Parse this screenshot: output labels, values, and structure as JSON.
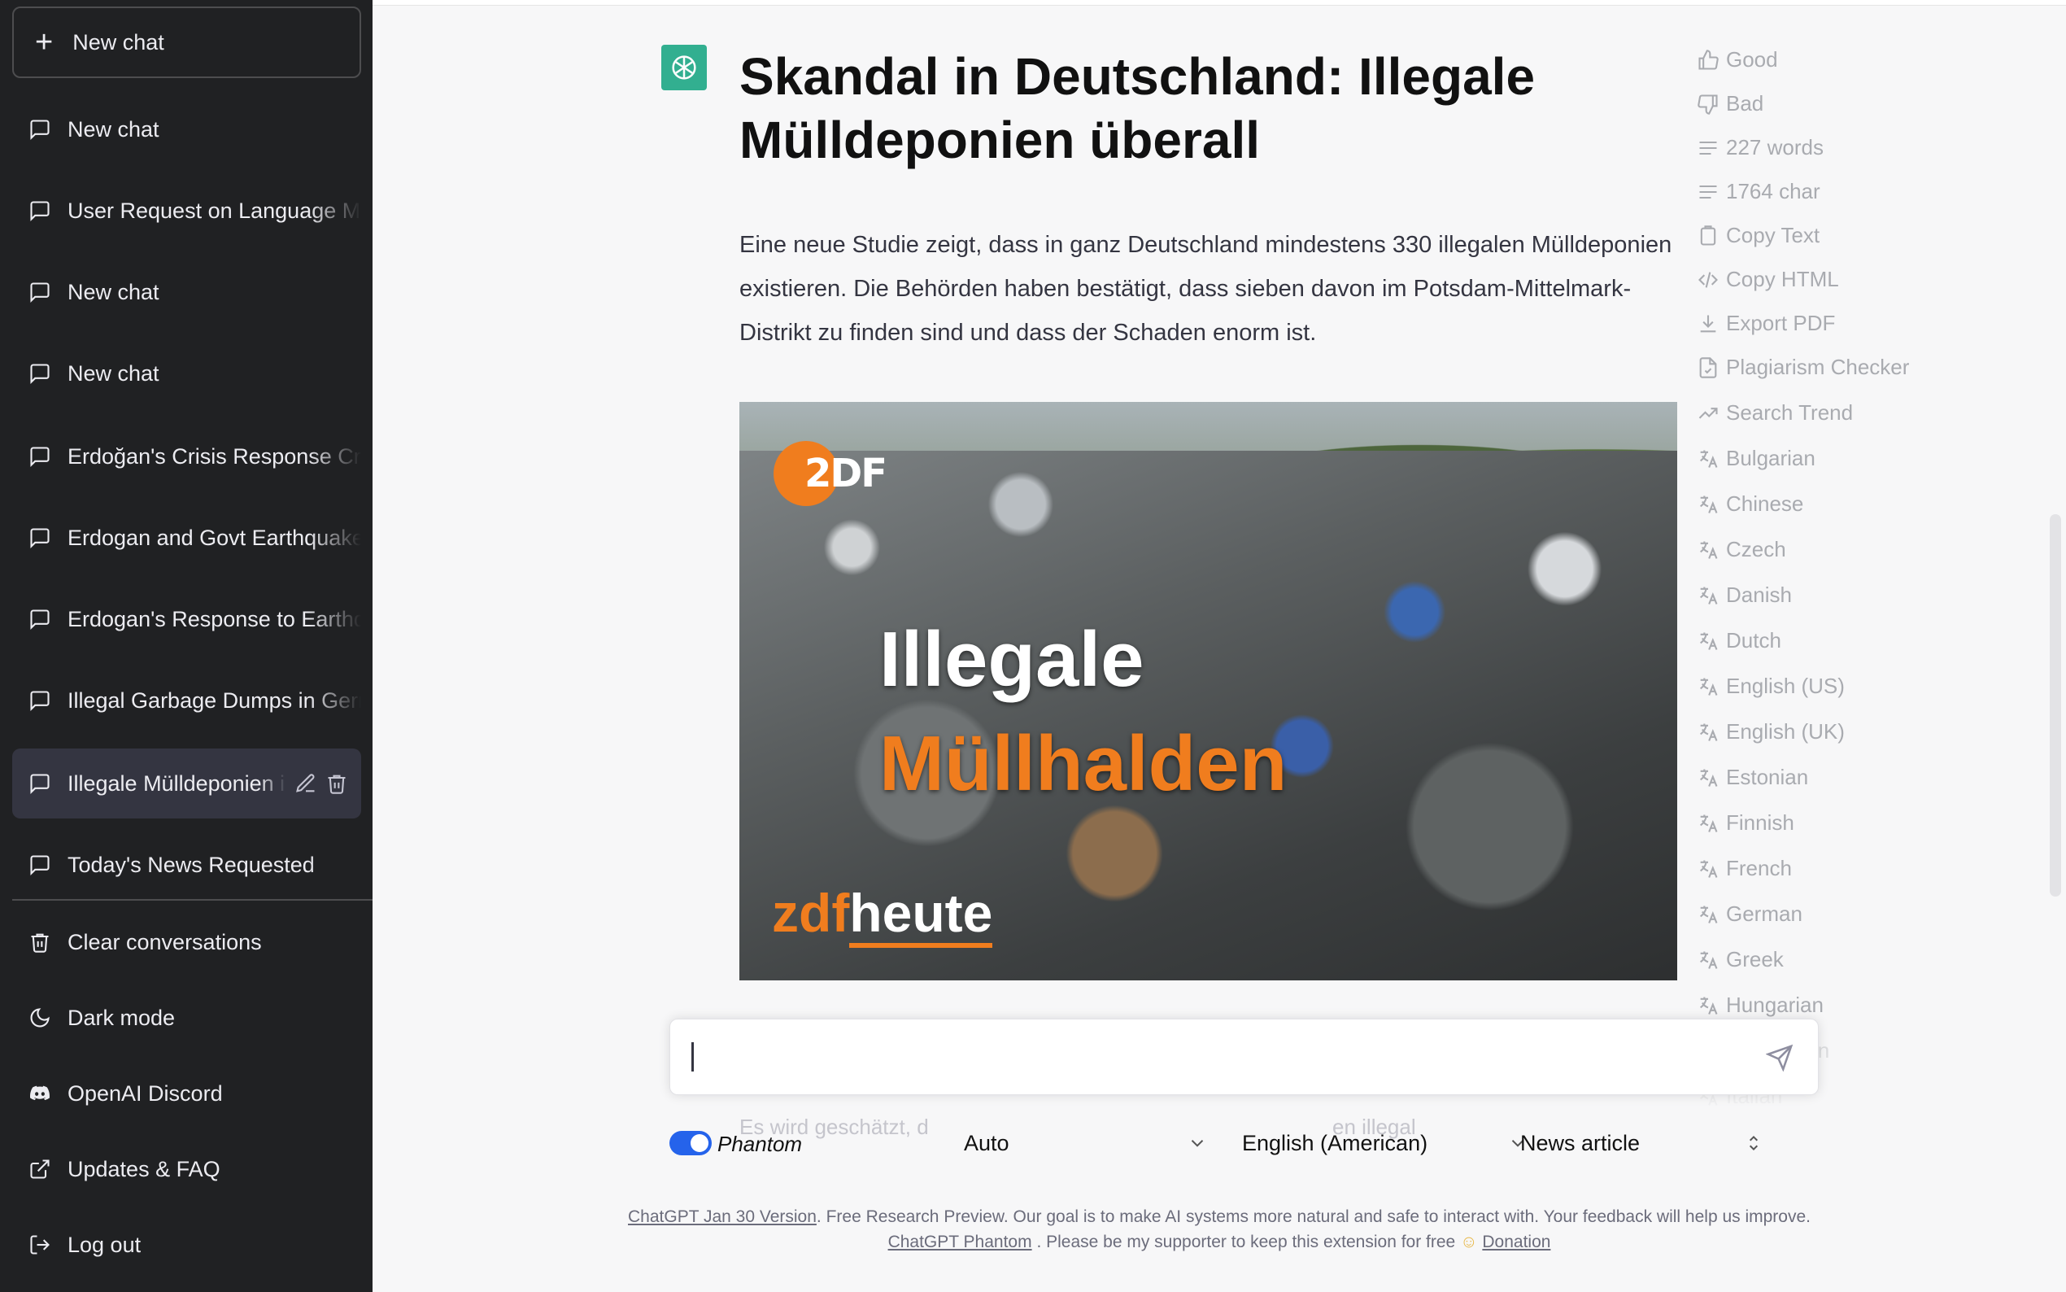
{
  "sidebar": {
    "new_chat": "New chat",
    "conversations": [
      {
        "label": "New chat"
      },
      {
        "label": "User Request on Language Model"
      },
      {
        "label": "New chat"
      },
      {
        "label": "New chat"
      },
      {
        "label": "Erdoğan's Crisis Response Criticized"
      },
      {
        "label": "Erdogan and Govt Earthquake"
      },
      {
        "label": "Erdogan's Response to Earthquake"
      },
      {
        "label": "Illegal Garbage Dumps in Germany"
      },
      {
        "label": "Illegale Mülldeponien in Deutschland"
      },
      {
        "label": "Today's News Requested"
      }
    ],
    "clear": "Clear conversations",
    "dark_mode": "Dark mode",
    "discord": "OpenAI Discord",
    "updates": "Updates & FAQ",
    "logout": "Log out"
  },
  "article": {
    "title": "Skandal in Deutschland: Illegale Mülldeponien überall",
    "paragraph": "Eine neue Studie zeigt, dass in ganz Deutschland mindestens 330 illegalen Mülldeponien existieren. Die Behörden haben bestätigt, dass sieben davon im Potsdam-Mittelmark-Distrikt zu finden sind und dass der Schaden enorm ist.",
    "image": {
      "logo": "2DF",
      "caption_line1": "Illegale",
      "caption_line2": "Müllhalden",
      "brand_part1": "zdf",
      "brand_part2": "heute"
    },
    "ghost_text_left": "Es wird geschätzt, d",
    "ghost_text_right": "en illegal"
  },
  "toolbar": {
    "good": "Good",
    "bad": "Bad",
    "words": "227 words",
    "chars": "1764 char",
    "copy_text": "Copy Text",
    "copy_html": "Copy HTML",
    "export_pdf": "Export PDF",
    "plagiarism": "Plagiarism Checker",
    "search_trend": "Search Trend",
    "languages": [
      "Bulgarian",
      "Chinese",
      "Czech",
      "Danish",
      "Dutch",
      "English (US)",
      "English (UK)",
      "Estonian",
      "Finnish",
      "French",
      "German",
      "Greek",
      "Hungarian",
      "Indonesian",
      "Italian"
    ]
  },
  "composer": {
    "placeholder": "",
    "phantom_label": "Phantom",
    "phantom_on": true,
    "tone": "Auto",
    "language": "English (American)",
    "format": "News article"
  },
  "footer": {
    "version_link": "ChatGPT Jan 30 Version",
    "line1_rest": ". Free Research Preview. Our goal is to make AI systems more natural and safe to interact with. Your feedback will help us improve.",
    "phantom_link": "ChatGPT Phantom",
    "line2_mid": ". Please be my supporter to keep this extension for free",
    "donation_link": "Donation"
  },
  "colors": {
    "sidebar_bg": "#202123",
    "main_bg": "#f7f7f8",
    "accent_green": "#10a37f",
    "toggle_blue": "#2563eb",
    "zdf_orange": "#f07d1e"
  }
}
